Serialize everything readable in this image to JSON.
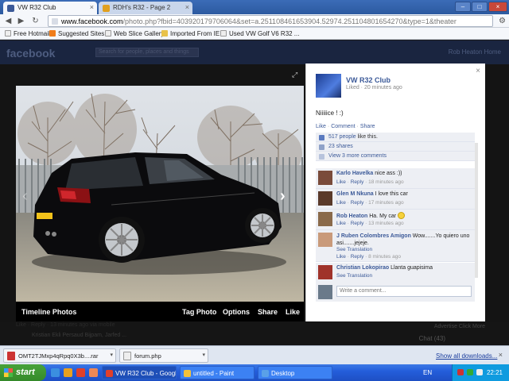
{
  "browser": {
    "tabs": [
      {
        "label": "VW R32 Club",
        "active": true
      },
      {
        "label": "RDH's R32 - Page 2",
        "active": false
      }
    ],
    "url_host": "www.facebook.com",
    "url_path": "/photo.php?fbid=403920179706064&set=a.251108461653904.52974.251104801654270&type=1&theater",
    "bookmarks": [
      "Free Hotmail",
      "Suggested Sites",
      "Web Slice Gallery",
      "Imported From IE",
      "Used VW Golf V6 R32 ..."
    ]
  },
  "fb": {
    "logo": "facebook",
    "search_placeholder": "Search for people, places and things",
    "header_right": "Rob Heaton   Home"
  },
  "theater": {
    "album_label": "Timeline Photos",
    "actions": [
      "Tag Photo",
      "Options",
      "Share",
      "Like"
    ],
    "next_glyph": "›",
    "prev_glyph": "‹"
  },
  "panel": {
    "page_name": "VW R32 Club",
    "meta": "Liked · 20 minutes ago",
    "caption": "Niiiiice ! :)",
    "links": [
      "Like",
      "Comment",
      "Share"
    ],
    "likes_count": "517 people",
    "likes_suffix": " like this.",
    "shares": "23 shares",
    "view_more": "View 3 more comments",
    "comments": [
      {
        "name": "Karlo Havelka",
        "text": " nice ass :))",
        "like": "Like",
        "reply": "Reply",
        "time": "18 minutes ago"
      },
      {
        "name": "Glen M Nkuna",
        "text": " I love this car",
        "like": "Like",
        "reply": "Reply",
        "time": "17 minutes ago"
      },
      {
        "name": "Rob Heaton",
        "text": " Ha. My car ",
        "like": "Like",
        "reply": "Reply",
        "time": "13 minutes ago"
      },
      {
        "name": "J Ruben Colombres Amigon",
        "text": " Wow.......Yo quiero uno asi.......jejeje.",
        "translation": "See Translation",
        "like": "Like",
        "reply": "Reply",
        "time": "8 minutes ago"
      },
      {
        "name": "Christian Lokopirao",
        "text": " Llanta guapisima",
        "translation": "See Translation"
      }
    ],
    "write_placeholder": "Write a comment..."
  },
  "background": {
    "left_text1": "Like · Reply · 13 minutes ago via mobile",
    "left_text2": "Kristian Ekli Persaud Bijpam, Jarfed ...",
    "chat": "Chat (43)",
    "right_text": "Advertise Click More"
  },
  "downloads": {
    "items": [
      "OMT2TJMxp4qRpq0X3b....rar",
      "forum.php"
    ],
    "show_all": "Show all downloads..."
  },
  "taskbar": {
    "start": "start",
    "tasks": [
      "VW R32 Club - Googl...",
      "untitled - Paint",
      "Desktop"
    ],
    "lang": "EN",
    "time": "22:21"
  },
  "colors": {
    "fb_blue": "#3b5998",
    "xp_blue": "#245edb",
    "start_green": "#358a2a"
  }
}
